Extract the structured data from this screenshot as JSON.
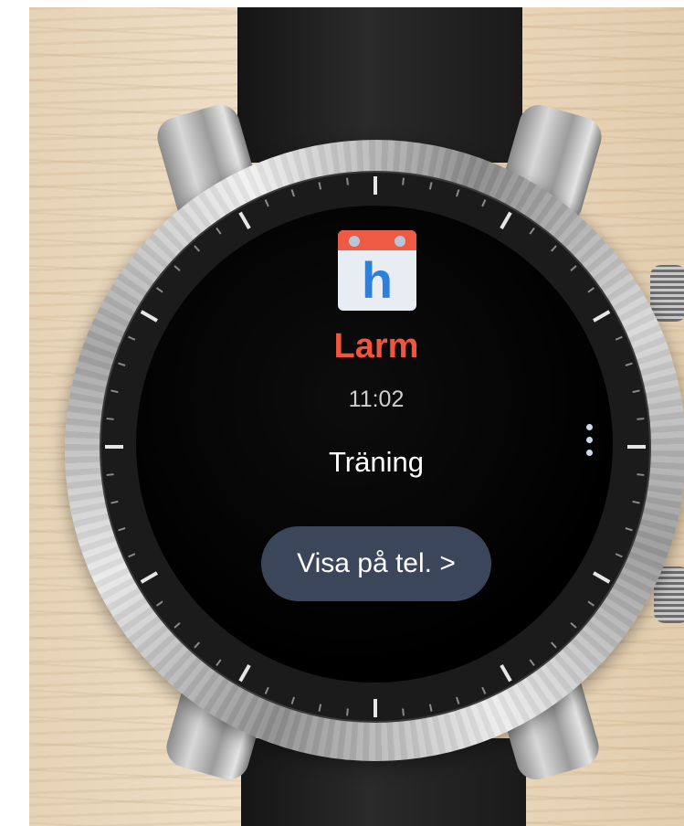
{
  "notification": {
    "app_icon_letter": "h",
    "title": "Larm",
    "time": "11:02",
    "event_name": "Träning",
    "action_label": "Visa på tel.",
    "action_chevron": ">"
  },
  "icons": {
    "app": "calendar-icon",
    "more": "more-options-icon"
  },
  "colors": {
    "title": "#f2553b",
    "app_icon_header": "#ee5a44",
    "app_icon_letter": "#2f7fd8",
    "action_button": "#3c465a"
  }
}
